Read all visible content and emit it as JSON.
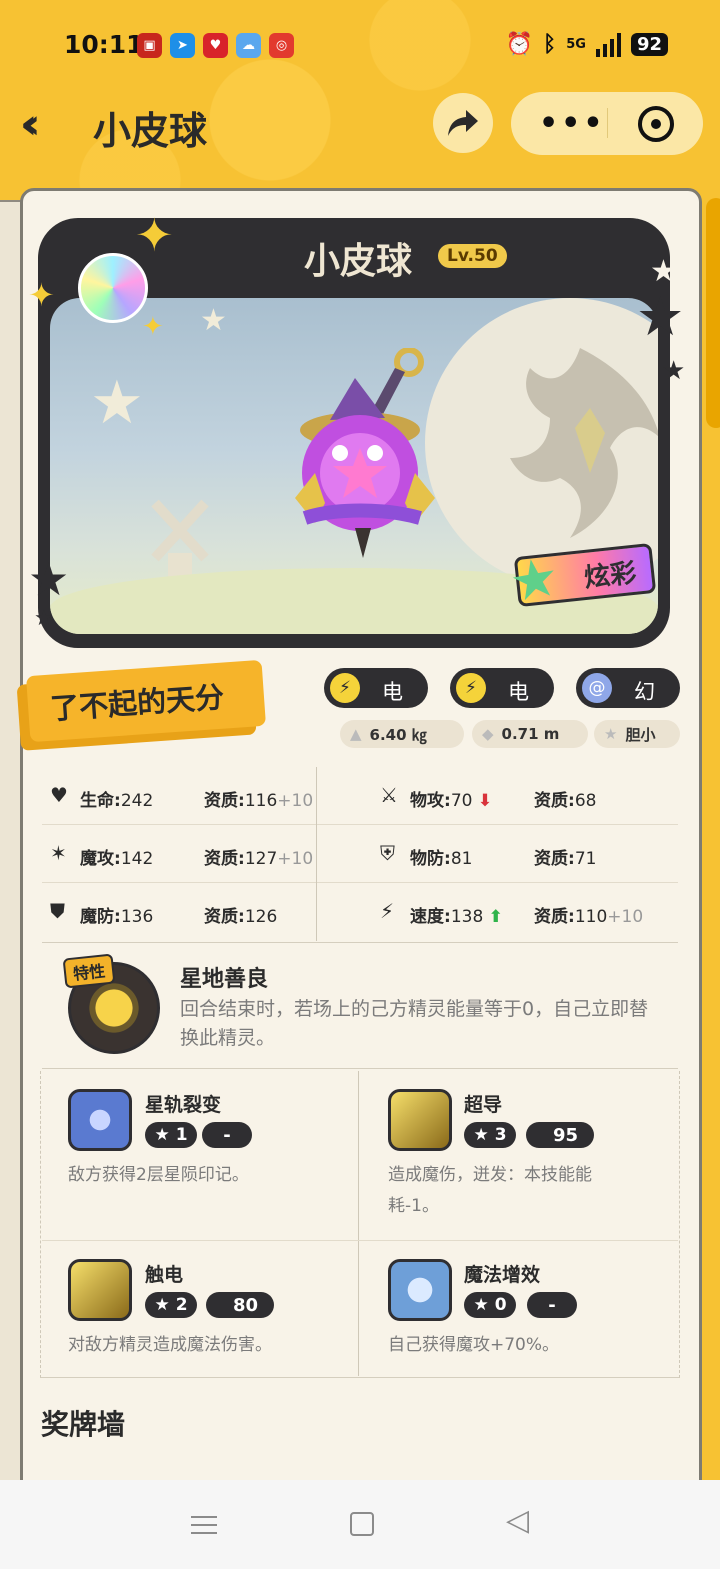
{
  "status_bar": {
    "time": "10:11",
    "battery": "92",
    "network": "5G"
  },
  "nav": {
    "back_icon": "double-chevron-left-icon",
    "title": "小皮球",
    "share_icon": "share-arrow-icon",
    "more_icon": "more-dots-icon",
    "close_icon": "target-icon"
  },
  "pet": {
    "name": "小皮球",
    "level": "Lv.50",
    "shiny_label": "炫彩",
    "talent": "了不起的天分"
  },
  "attributes": [
    {
      "label": "电",
      "color": "#f5d33a",
      "icon": "lightning-icon"
    },
    {
      "label": "电",
      "color": "#f5d33a",
      "icon": "lightning-icon"
    },
    {
      "label": "幻",
      "color": "#8fa7e8",
      "icon": "spiral-icon"
    }
  ],
  "measures": [
    {
      "value": "6.40 ㎏",
      "icon": "weight-icon"
    },
    {
      "value": "0.71 m",
      "icon": "ruler-icon"
    },
    {
      "value": "胆小",
      "icon": "star-icon"
    }
  ],
  "stats": [
    {
      "name": "生命:",
      "value": "242",
      "apt_label": "资质:",
      "apt": "116",
      "apt_bonus": "+10",
      "icon": "heart-icon"
    },
    {
      "name": "物攻:",
      "value": "70",
      "apt_label": "资质:",
      "apt": "68",
      "apt_bonus": "",
      "icon": "sword-icon",
      "trend": "down"
    },
    {
      "name": "魔攻:",
      "value": "142",
      "apt_label": "资质:",
      "apt": "127",
      "apt_bonus": "+10",
      "icon": "magic-wand-icon"
    },
    {
      "name": "物防:",
      "value": "81",
      "apt_label": "资质:",
      "apt": "71",
      "apt_bonus": "",
      "icon": "shield-icon"
    },
    {
      "name": "魔防:",
      "value": "136",
      "apt_label": "资质:",
      "apt": "126",
      "apt_bonus": "",
      "icon": "magic-shield-icon"
    },
    {
      "name": "速度:",
      "value": "138",
      "apt_label": "资质:",
      "apt": "110",
      "apt_bonus": "+10",
      "icon": "boot-icon",
      "trend": "up"
    }
  ],
  "trait": {
    "tag": "特性",
    "name": "星地善良",
    "desc": "回合结束时，若场上的己方精灵能量等于0，自己立即替换此精灵。"
  },
  "skills": [
    {
      "name": "星轨裂变",
      "stars": "1",
      "cost": "-",
      "desc": "敌方获得2层星陨印记。",
      "icon": "star-orbit-icon",
      "color": "#5a7ad0"
    },
    {
      "name": "超导",
      "stars": "3",
      "cost": "95",
      "desc": "造成魔伤，迸发：本技能能耗-1。",
      "icon": "electric-icon",
      "color": "#d9b23a"
    },
    {
      "name": "触电",
      "stars": "2",
      "cost": "80",
      "desc": "对敌方精灵造成魔法伤害。",
      "icon": "shock-icon",
      "color": "#d9b23a"
    },
    {
      "name": "魔法增效",
      "stars": "0",
      "cost": "-",
      "desc": "自己获得魔攻+70%。",
      "icon": "magic-boost-icon",
      "color": "#6e9fd8"
    }
  ],
  "medal_wall": "奖牌墙"
}
